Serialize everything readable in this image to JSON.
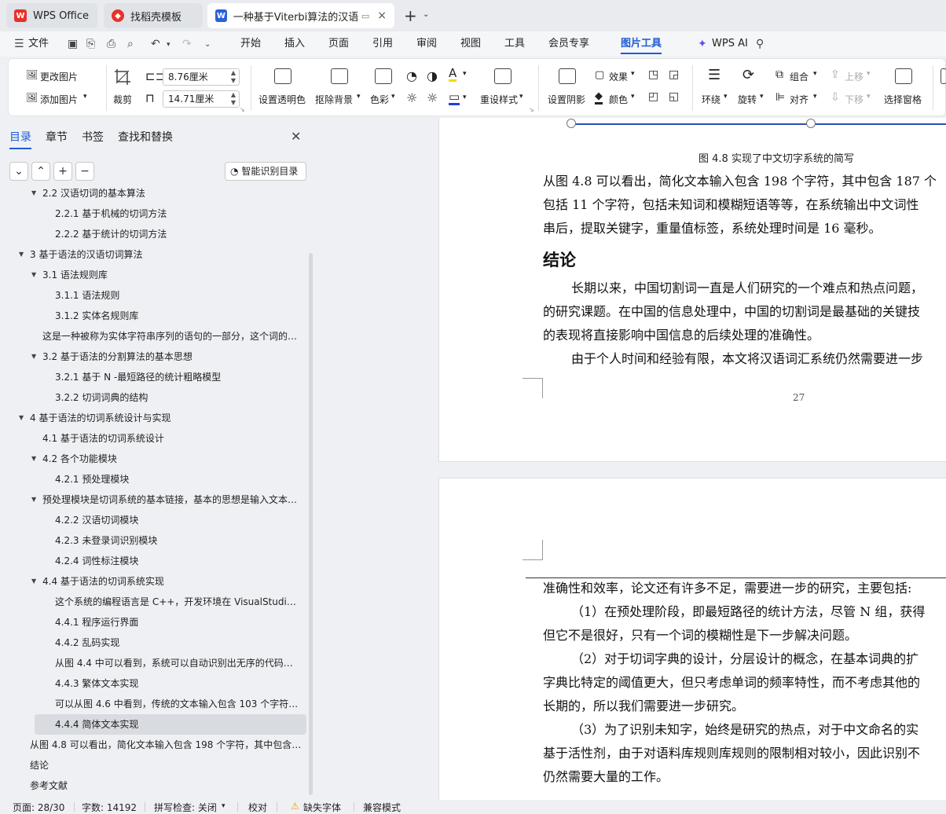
{
  "tabs": [
    {
      "label": "WPS Office",
      "icon": "wps-logo-icon"
    },
    {
      "label": "找稻壳模板",
      "icon": "docer-icon"
    },
    {
      "label": "一种基于Viterbi算法的汉语切",
      "icon": "word-doc-icon",
      "close": "×"
    }
  ],
  "new_tab": "+",
  "menu": {
    "file": "文件",
    "items": [
      "开始",
      "插入",
      "页面",
      "引用",
      "审阅",
      "视图",
      "工具",
      "会员专享",
      "图片工具"
    ],
    "active": "图片工具",
    "wps_ai": "WPS AI"
  },
  "ribbon": {
    "change_pic": "更改图片",
    "add_pic": "添加图片",
    "crop": "裁剪",
    "width": "8.76厘米",
    "height": "14.71厘米",
    "set_transparent": "设置透明色",
    "remove_bg": "抠除背景",
    "color": "色彩",
    "reset_style": "重设样式",
    "set_shadow": "设置阴影",
    "effect": "效果",
    "color2": "颜色",
    "wrap": "环绕",
    "rotate": "旋转",
    "group": "组合",
    "align": "对齐",
    "move_up": "上移",
    "move_down": "下移",
    "selection_pane": "选择窗格"
  },
  "sidebar": {
    "tabs": [
      "目录",
      "章节",
      "书签",
      "查找和替换"
    ],
    "active_tab": "目录",
    "smart_toc": "智能识别目录",
    "toc": [
      {
        "label": "2.2 汉语切词的基本算法",
        "level": 1,
        "tri": true
      },
      {
        "label": "2.2.1  基于机械的切词方法",
        "level": 2
      },
      {
        "label": "2.2.2  基于统计的切词方法",
        "level": 2
      },
      {
        "label": "3 基于语法的汉语切词算法",
        "level": 0,
        "tri": true
      },
      {
        "label": "3.1  语法规则库",
        "level": 1,
        "tri": true
      },
      {
        "label": "3.1.1  语法规则",
        "level": 2
      },
      {
        "label": "3.1.2  实体名规则库",
        "level": 2
      },
      {
        "label": "这是一种被称为实体字符串序列的语句的一部分，这个词的…",
        "level": 1
      },
      {
        "label": "3.2 基于语法的分割算法的基本思想",
        "level": 1,
        "tri": true
      },
      {
        "label": "3.2.1 基于 N -最短路径的统计粗略模型",
        "level": 2
      },
      {
        "label": "3.2.2  切词词典的结构",
        "level": 2
      },
      {
        "label": "4  基于语法的切词系统设计与实现",
        "level": 0,
        "tri": true
      },
      {
        "label": "4.1 基于语法的切词系统设计",
        "level": 1
      },
      {
        "label": "4.2 各个功能模块",
        "level": 1,
        "tri": true
      },
      {
        "label": "4.2.1  预处理模块",
        "level": 2
      },
      {
        "label": "预处理模块是切词系统的基本链接，基本的思想是输入文本…",
        "level": 1,
        "tri": true
      },
      {
        "label": "4.2.2  汉语切词模块",
        "level": 2
      },
      {
        "label": "4.2.3  未登录词识别模块",
        "level": 2
      },
      {
        "label": "4.2.4  词性标注模块",
        "level": 2
      },
      {
        "label": "4.4  基于语法的切词系统实现",
        "level": 1,
        "tri": true
      },
      {
        "label": "这个系统的编程语言是 C++，开发环境在 VisualStudio …",
        "level": 2
      },
      {
        "label": "4.4.1  程序运行界面",
        "level": 2
      },
      {
        "label": "4.4.2  乱码实现",
        "level": 2
      },
      {
        "label": "从图 4.4 中可以看到，系统可以自动识别出无序的代码而…",
        "level": 2
      },
      {
        "label": "4.4.3  繁体文本实现",
        "level": 2
      },
      {
        "label": "可以从图 4.6 中看到，传统的文本输入包含 103 个字符…",
        "level": 2
      },
      {
        "label": "4.4.4  简体文本实现",
        "level": 2,
        "selected": true
      },
      {
        "label": "从图 4.8 可以看出，简化文本输入包含 198 个字符，其中包含…",
        "level": 0
      },
      {
        "label": "结论",
        "level": 0
      },
      {
        "label": "参考文献",
        "level": 0
      }
    ]
  },
  "doc": {
    "caption": "图  4.8  实现了中文切字系统的简写",
    "p1": [
      "从图 4.8 可以看出，简化文本输入包含 198 个字符，其中包含 187 个",
      "包括 11 个字符，包括未知词和模糊短语等等，在系统输出中文词性",
      "串后，提取关键字，重量值标签，系统处理时间是 16 毫秒。"
    ],
    "heading": "结论",
    "p2": [
      "长期以来，中国切割词一直是人们研究的一个难点和热点问题，",
      "的研究课题。在中国的信息处理中，中国的切割词是最基础的关键技",
      "的表现将直接影响中国信息的后续处理的准确性。",
      "由于个人时间和经验有限，本文将汉语词汇系统仍然需要进一步"
    ],
    "page_number": "27",
    "p3": [
      "准确性和效率，论文还有许多不足，需要进一步的研究，主要包括:",
      "（1）在预处理阶段，即最短路径的统计方法，尽管 N 组，获得",
      "但它不是很好，只有一个词的模糊性是下一步解决问题。",
      "（2）对于切词字典的设计，分层设计的概念，在基本词典的扩",
      "字典比特定的阈值更大，但只考虑单词的频率特性，而不考虑其他的",
      "长期的，所以我们需要进一步研究。",
      "（3）为了识别未知字，始终是研究的热点，对于中文命名的实",
      "基于活性剂，由于对语料库规则库规则的限制相对较小，因此识别不",
      "仍然需要大量的工作。"
    ]
  },
  "status": {
    "page": "页面: 28/30",
    "words": "字数: 14192",
    "spell": "拼写检查: 关闭",
    "proof": "校对",
    "missing_font": "缺失字体",
    "compat": "兼容模式"
  },
  "colors": {
    "accent": "#1e5bd6",
    "wps_red": "#e8312a"
  }
}
